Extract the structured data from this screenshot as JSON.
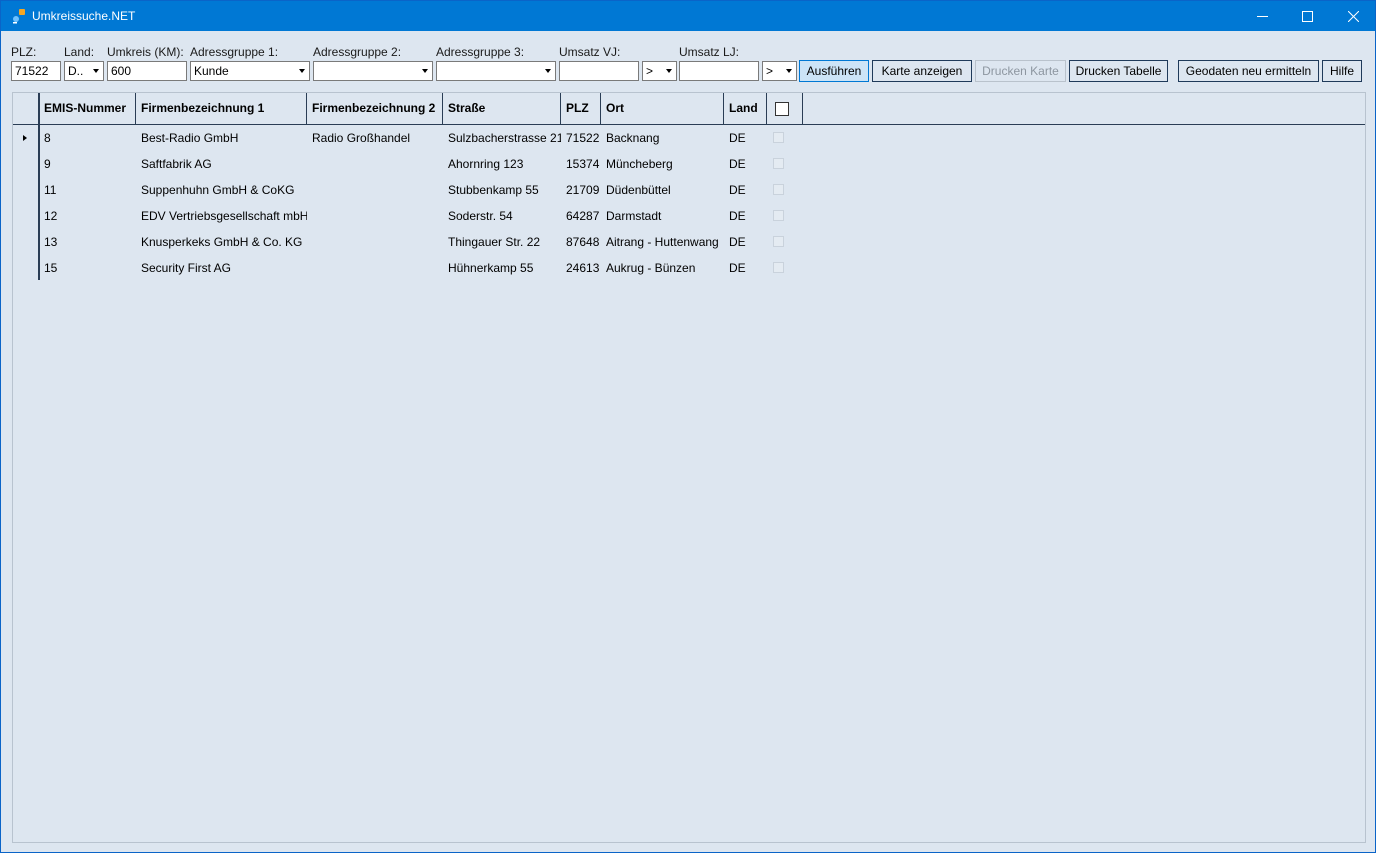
{
  "window": {
    "title": "Umkreissuche.NET",
    "controls": {
      "minimize": "minimize-icon",
      "maximize": "maximize-icon",
      "close": "close-icon"
    }
  },
  "filters": {
    "plz": {
      "label": "PLZ:",
      "value": "71522"
    },
    "land": {
      "label": "Land:",
      "value": "D.."
    },
    "umkreis": {
      "label": "Umkreis (KM):",
      "value": "600"
    },
    "adressgruppe1": {
      "label": "Adressgruppe 1:",
      "value": "Kunde"
    },
    "adressgruppe2": {
      "label": "Adressgruppe 2:",
      "value": ""
    },
    "adressgruppe3": {
      "label": "Adressgruppe 3:",
      "value": ""
    },
    "umsatz_vj": {
      "label": "Umsatz VJ:",
      "value": "",
      "operator": ">"
    },
    "umsatz_lj": {
      "label": "Umsatz LJ:",
      "value": "",
      "operator": ">"
    }
  },
  "toolbar": {
    "ausfuehren": "Ausführen",
    "karte_anzeigen": "Karte anzeigen",
    "drucken_karte": "Drucken Karte",
    "drucken_tabelle": "Drucken Tabelle",
    "geodaten": "Geodaten neu ermitteln",
    "hilfe": "Hilfe"
  },
  "table": {
    "columns": [
      "EMIS-Nummer",
      "Firmenbezeichnung 1",
      "Firmenbezeichnung 2",
      "Straße",
      "PLZ",
      "Ort",
      "Land"
    ],
    "rows": [
      {
        "emis": "8",
        "firma1": "Best-Radio GmbH",
        "firma2": "Radio Großhandel",
        "strasse": "Sulzbacherstrasse 21",
        "plz": "71522",
        "ort": "Backnang",
        "land": "DE"
      },
      {
        "emis": "9",
        "firma1": "Saftfabrik AG",
        "firma2": "",
        "strasse": "Ahornring 123",
        "plz": "15374",
        "ort": "Müncheberg",
        "land": "DE"
      },
      {
        "emis": "11",
        "firma1": "Suppenhuhn GmbH & CoKG",
        "firma2": "",
        "strasse": "Stubbenkamp 55",
        "plz": "21709",
        "ort": "Düdenbüttel",
        "land": "DE"
      },
      {
        "emis": "12",
        "firma1": "EDV Vertriebsgesellschaft mbH",
        "firma2": "",
        "strasse": "Soderstr. 54",
        "plz": "64287",
        "ort": "Darmstadt",
        "land": "DE"
      },
      {
        "emis": "13",
        "firma1": "Knusperkeks GmbH & Co. KG",
        "firma2": "",
        "strasse": "Thingauer Str. 22",
        "plz": "87648",
        "ort": "Aitrang - Huttenwang",
        "land": "DE"
      },
      {
        "emis": "15",
        "firma1": "Security First AG",
        "firma2": "",
        "strasse": "Hühnerkamp 55",
        "plz": "24613",
        "ort": "Aukrug - Bünzen",
        "land": "DE"
      }
    ]
  },
  "colors": {
    "titlebar": "#0078d4",
    "background": "#dde6f0",
    "accent_button": "#cce4f7"
  }
}
